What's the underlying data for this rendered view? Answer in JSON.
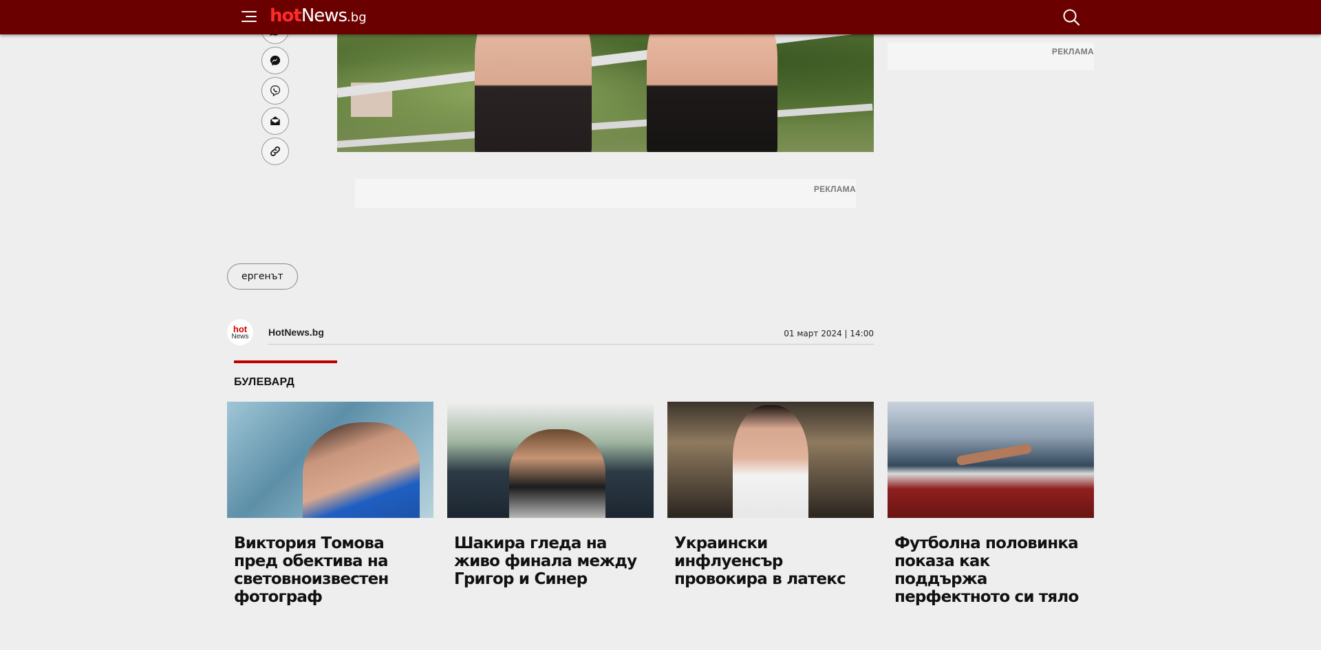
{
  "header": {
    "logo_hot": "hot",
    "logo_news": "News",
    "logo_tld": ".bg",
    "menu_icon": "hamburger-icon",
    "search_icon": "search-icon",
    "background_color": "#6b0000",
    "accent_color": "#ff2b2b"
  },
  "share": {
    "items": [
      {
        "name": "whatsapp",
        "icon": "whatsapp-icon"
      },
      {
        "name": "messenger",
        "icon": "messenger-icon"
      },
      {
        "name": "viber",
        "icon": "viber-icon"
      },
      {
        "name": "email",
        "icon": "email-icon"
      },
      {
        "name": "copy-link",
        "icon": "link-icon"
      }
    ]
  },
  "ads": {
    "side_label": "РЕКЛАМА",
    "main_label": "РЕКЛАМА"
  },
  "tags": [
    "ергенът"
  ],
  "author": {
    "avatar_hot": "hot",
    "avatar_news": "News",
    "name": "HotNews.bg",
    "date": "01 март 2024 | 14:00"
  },
  "section": {
    "title": "БУЛЕВАРД",
    "accent_color": "#c00000"
  },
  "articles": [
    {
      "title": "Виктория Томова пред обектива на световноизвестен фотограф"
    },
    {
      "title": "Шакира гледа на живо финала между Григор и Синер"
    },
    {
      "title": "Украински инфлуенсър провокира в латекс"
    },
    {
      "title": "Футболна половинка показа как поддържа перфектното си тяло"
    }
  ]
}
